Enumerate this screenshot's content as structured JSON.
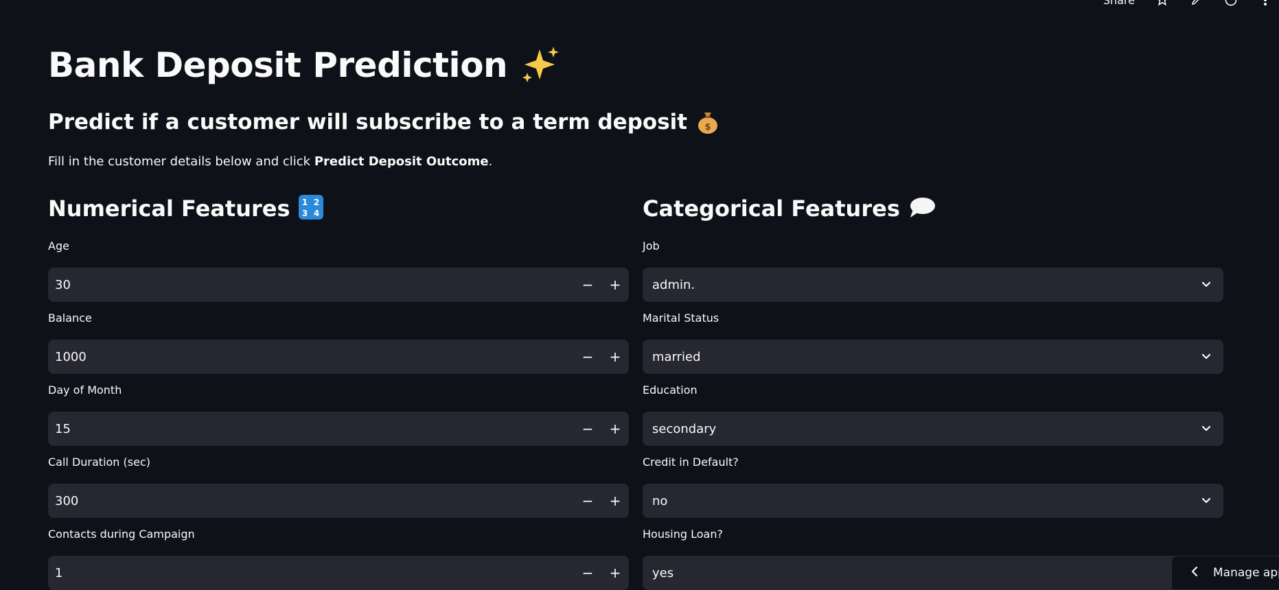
{
  "toolbar": {
    "share_label": "Share",
    "icons": [
      "star-icon",
      "edit-icon",
      "github-icon",
      "kebab-menu-icon"
    ]
  },
  "page": {
    "title": "Bank Deposit Prediction",
    "title_emoji": "sparkles",
    "subtitle": "Predict if a customer will subscribe to a term deposit",
    "subtitle_emoji": "money-bag",
    "intro_prefix": "Fill in the customer details below and click ",
    "intro_bold": "Predict Deposit Outcome",
    "intro_suffix": "."
  },
  "numerical": {
    "heading": "Numerical Features",
    "heading_emoji": "input-numbers",
    "fields": [
      {
        "label": "Age",
        "value": "30"
      },
      {
        "label": "Balance",
        "value": "1000"
      },
      {
        "label": "Day of Month",
        "value": "15"
      },
      {
        "label": "Call Duration (sec)",
        "value": "300"
      },
      {
        "label": "Contacts during Campaign",
        "value": "1"
      }
    ],
    "minus": "−",
    "plus": "+"
  },
  "categorical": {
    "heading": "Categorical Features",
    "heading_emoji": "speech-balloon",
    "fields": [
      {
        "label": "Job",
        "value": "admin."
      },
      {
        "label": "Marital Status",
        "value": "married"
      },
      {
        "label": "Education",
        "value": "secondary"
      },
      {
        "label": "Credit in Default?",
        "value": "no"
      },
      {
        "label": "Housing Loan?",
        "value": "yes"
      }
    ]
  },
  "manage_app": {
    "label": "Manage app"
  }
}
